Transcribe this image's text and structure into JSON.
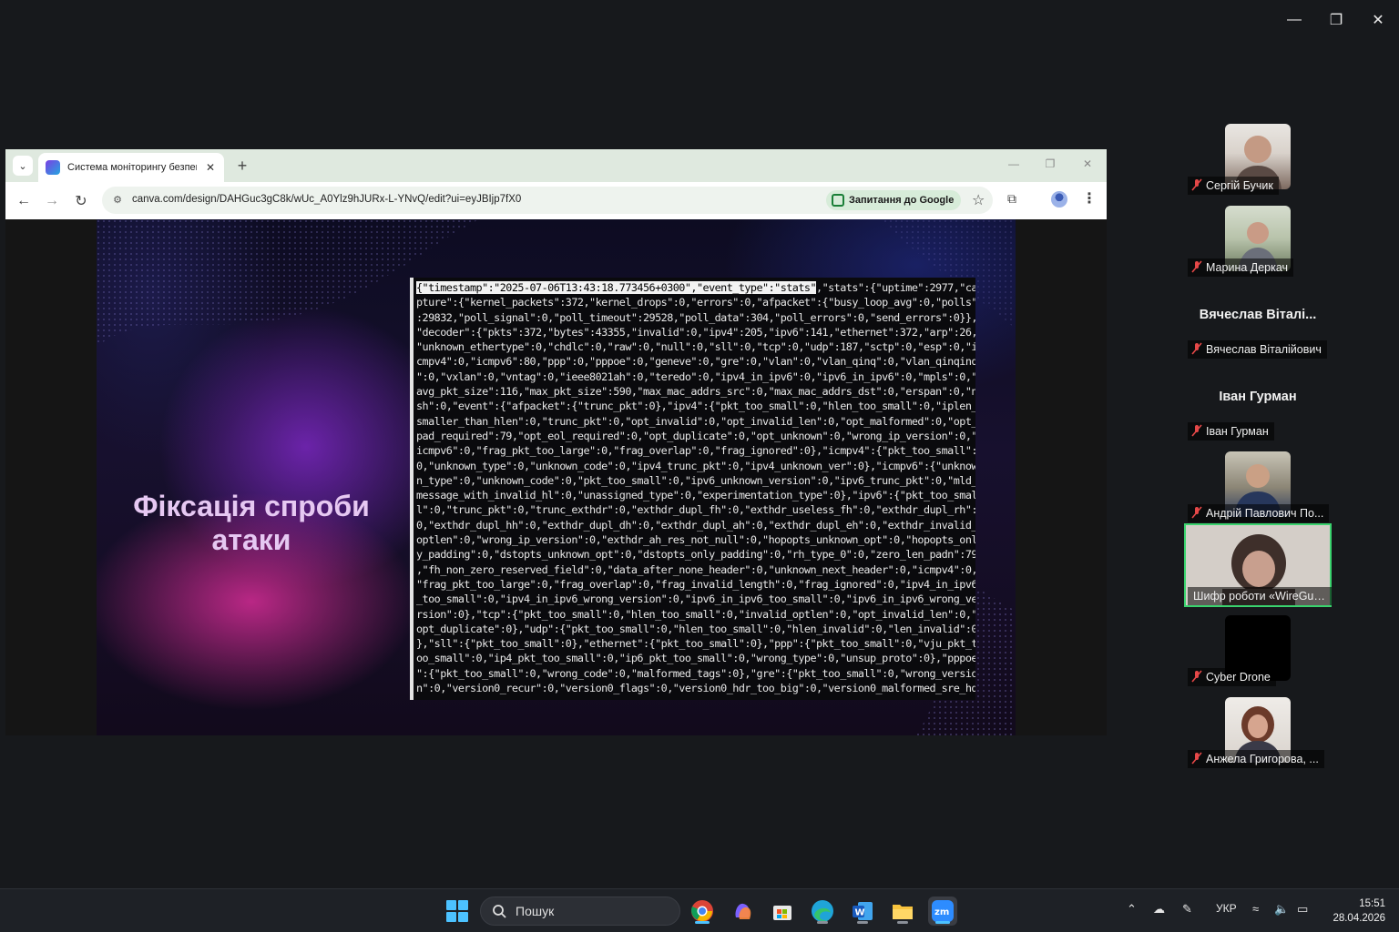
{
  "zoom_window": {
    "controls": [
      "minimize",
      "restore",
      "close"
    ]
  },
  "browser": {
    "tab": {
      "title": "Система моніторингу безпеки",
      "favicon": "canva-icon"
    },
    "url": "canva.com/design/DAHGuc3gC8k/wUc_A0Ylz9hJURx-L-YNvQ/edit?ui=eyJBIjp7fX0",
    "google_chip_label": "Запитання до Google"
  },
  "slide": {
    "title_line1": "Фіксація спроби",
    "title_line2": "атаки",
    "terminal_highlight": "{\"timestamp\":\"2025-07-06T13:43:18.773456+0300\",\"event_type\":\"stats\"",
    "terminal_lines": [
      ",\"stats\":{\"uptime\":2977,\"ca",
      "pture\":{\"kernel_packets\":372,\"kernel_drops\":0,\"errors\":0,\"afpacket\":{\"busy_loop_avg\":0,\"polls\"",
      ":29832,\"poll_signal\":0,\"poll_timeout\":29528,\"poll_data\":304,\"poll_errors\":0,\"send_errors\":0}},",
      "\"decoder\":{\"pkts\":372,\"bytes\":43355,\"invalid\":0,\"ipv4\":205,\"ipv6\":141,\"ethernet\":372,\"arp\":26,",
      "\"unknown_ethertype\":0,\"chdlc\":0,\"raw\":0,\"null\":0,\"sll\":0,\"tcp\":0,\"udp\":187,\"sctp\":0,\"esp\":0,\"i",
      "cmpv4\":0,\"icmpv6\":80,\"ppp\":0,\"pppoe\":0,\"geneve\":0,\"gre\":0,\"vlan\":0,\"vlan_qinq\":0,\"vlan_qinqinq",
      "\":0,\"vxlan\":0,\"vntag\":0,\"ieee8021ah\":0,\"teredo\":0,\"ipv4_in_ipv6\":0,\"ipv6_in_ipv6\":0,\"mpls\":0,\"",
      "avg_pkt_size\":116,\"max_pkt_size\":590,\"max_mac_addrs_src\":0,\"max_mac_addrs_dst\":0,\"erspan\":0,\"n",
      "sh\":0,\"event\":{\"afpacket\":{\"trunc_pkt\":0},\"ipv4\":{\"pkt_too_small\":0,\"hlen_too_small\":0,\"iplen_",
      "smaller_than_hlen\":0,\"trunc_pkt\":0,\"opt_invalid\":0,\"opt_invalid_len\":0,\"opt_malformed\":0,\"opt_",
      "pad_required\":79,\"opt_eol_required\":0,\"opt_duplicate\":0,\"opt_unknown\":0,\"wrong_ip_version\":0,\"",
      "icmpv6\":0,\"frag_pkt_too_large\":0,\"frag_overlap\":0,\"frag_ignored\":0},\"icmpv4\":{\"pkt_too_small\":",
      "0,\"unknown_type\":0,\"unknown_code\":0,\"ipv4_trunc_pkt\":0,\"ipv4_unknown_ver\":0},\"icmpv6\":{\"unknow",
      "n_type\":0,\"unknown_code\":0,\"pkt_too_small\":0,\"ipv6_unknown_version\":0,\"ipv6_trunc_pkt\":0,\"mld_",
      "message_with_invalid_hl\":0,\"unassigned_type\":0,\"experimentation_type\":0},\"ipv6\":{\"pkt_too_smal",
      "l\":0,\"trunc_pkt\":0,\"trunc_exthdr\":0,\"exthdr_dupl_fh\":0,\"exthdr_useless_fh\":0,\"exthdr_dupl_rh\":",
      "0,\"exthdr_dupl_hh\":0,\"exthdr_dupl_dh\":0,\"exthdr_dupl_ah\":0,\"exthdr_dupl_eh\":0,\"exthdr_invalid_",
      "optlen\":0,\"wrong_ip_version\":0,\"exthdr_ah_res_not_null\":0,\"hopopts_unknown_opt\":0,\"hopopts_onl",
      "y_padding\":0,\"dstopts_unknown_opt\":0,\"dstopts_only_padding\":0,\"rh_type_0\":0,\"zero_len_padn\":79",
      ",\"fh_non_zero_reserved_field\":0,\"data_after_none_header\":0,\"unknown_next_header\":0,\"icmpv4\":0,",
      "\"frag_pkt_too_large\":0,\"frag_overlap\":0,\"frag_invalid_length\":0,\"frag_ignored\":0,\"ipv4_in_ipv6",
      "_too_small\":0,\"ipv4_in_ipv6_wrong_version\":0,\"ipv6_in_ipv6_too_small\":0,\"ipv6_in_ipv6_wrong_ve",
      "rsion\":0},\"tcp\":{\"pkt_too_small\":0,\"hlen_too_small\":0,\"invalid_optlen\":0,\"opt_invalid_len\":0,\"",
      "opt_duplicate\":0},\"udp\":{\"pkt_too_small\":0,\"hlen_too_small\":0,\"hlen_invalid\":0,\"len_invalid\":0",
      "},\"sll\":{\"pkt_too_small\":0},\"ethernet\":{\"pkt_too_small\":0},\"ppp\":{\"pkt_too_small\":0,\"vju_pkt_t",
      "oo_small\":0,\"ip4_pkt_too_small\":0,\"ip6_pkt_too_small\":0,\"wrong_type\":0,\"unsup_proto\":0},\"pppoe",
      "\":{\"pkt_too_small\":0,\"wrong_code\":0,\"malformed_tags\":0},\"gre\":{\"pkt_too_small\":0,\"wrong_versio",
      "n\":0,\"version0_recur\":0,\"version0_flags\":0,\"version0_hdr_too_big\":0,\"version0_malformed_sre_hd"
    ]
  },
  "participants": {
    "p1": {
      "name": "Сергій Бучик",
      "muted": true
    },
    "p2": {
      "name": "Марина Деркач",
      "muted": true
    },
    "p3": {
      "heading": "Вячеслав Віталі...",
      "name": "Вячеслав Віталійович",
      "muted": true
    },
    "p4": {
      "heading": "Іван Гурман",
      "name": "Іван Гурман",
      "muted": true
    },
    "p5": {
      "name": "Андрій Павлович По...",
      "muted": true
    },
    "p6": {
      "name": "Шифр роботи «WireGua...",
      "muted": false,
      "active": true
    },
    "p7": {
      "name": "Cyber Drone",
      "muted": true
    },
    "p8": {
      "name": "Анжела Григорова, ...",
      "muted": true
    }
  },
  "taskbar": {
    "search_placeholder": "Пошук",
    "apps": [
      "chrome-icon",
      "copilot-icon",
      "store-icon",
      "edge-icon",
      "word-icon",
      "file-explorer-icon",
      "zoom-icon"
    ],
    "language": "УКР",
    "time": "15:51",
    "date": "28.04.2026"
  },
  "colors": {
    "accent_active_speaker": "#3ad36e",
    "slide_title": "#e6c8f2",
    "windows_accent": "#4cc2ff"
  }
}
